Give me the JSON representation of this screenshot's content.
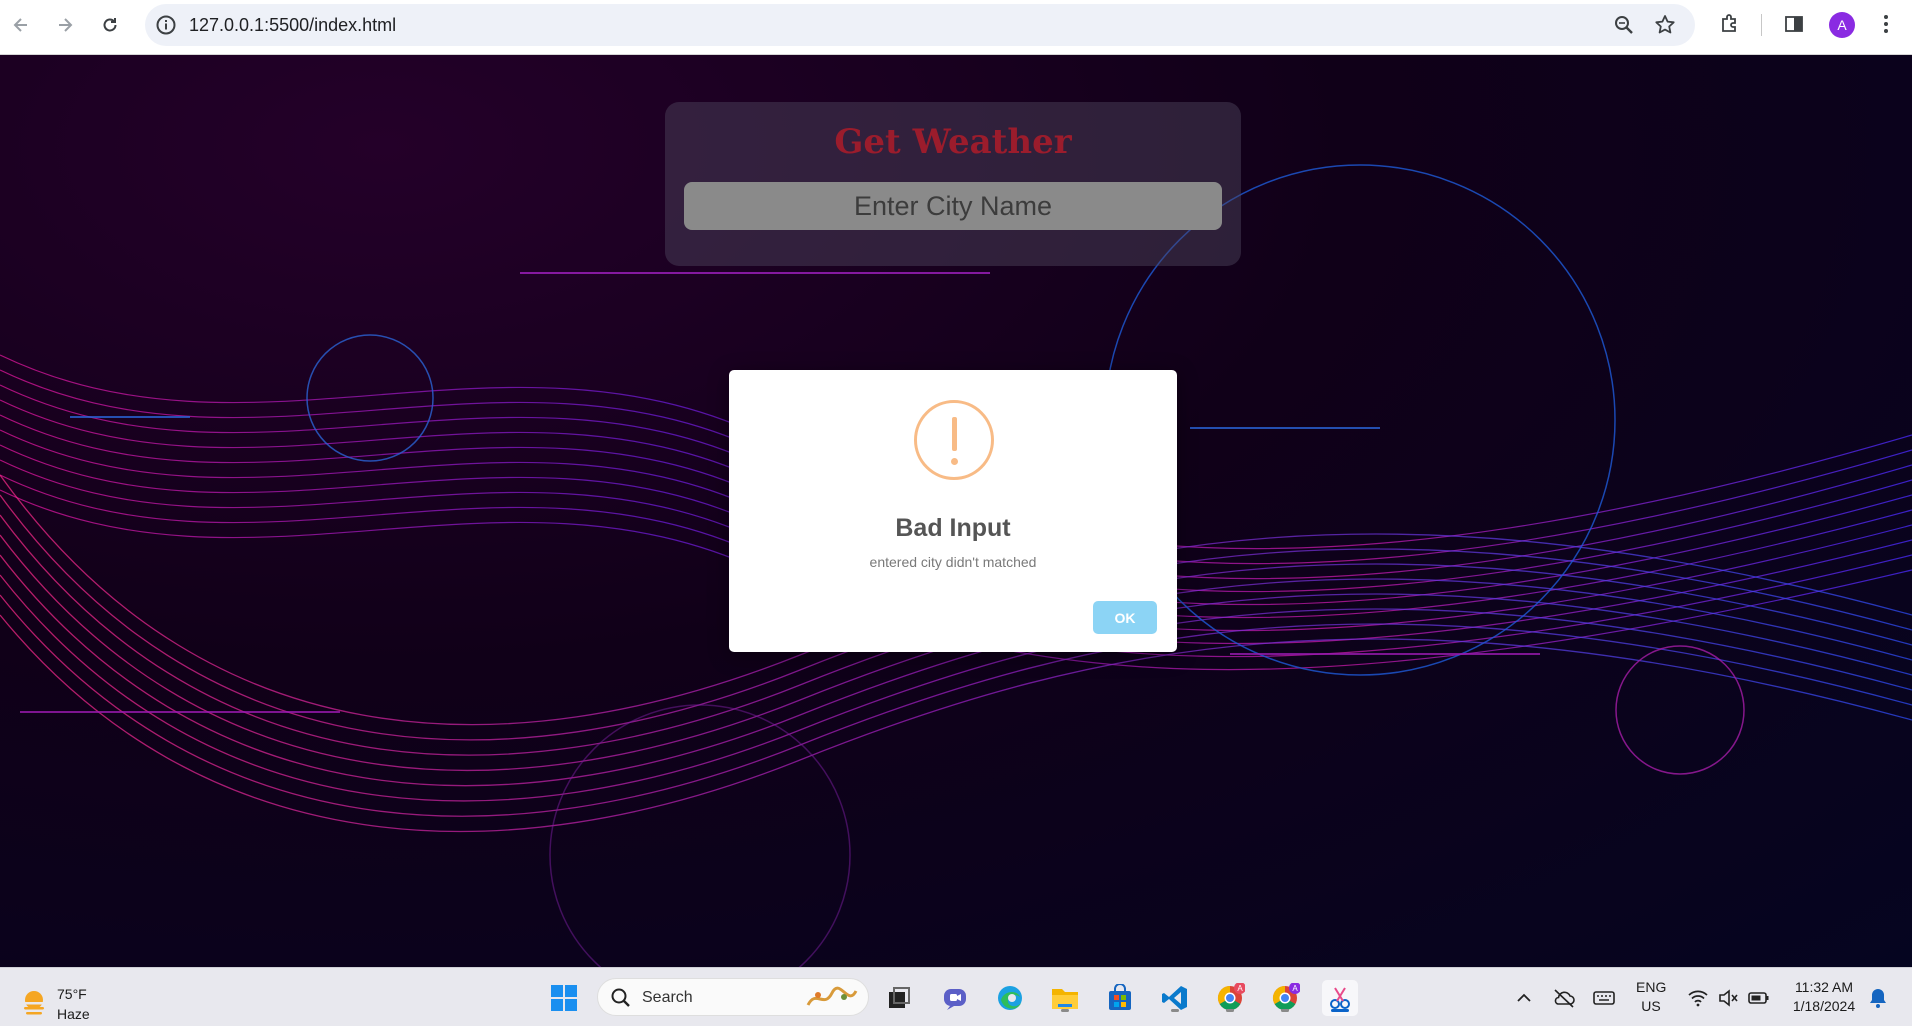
{
  "browser": {
    "url": "127.0.0.1:5500/index.html",
    "profile_initial": "A",
    "icons": [
      "back-icon",
      "forward-icon",
      "reload-icon",
      "site-info-icon",
      "zoom-icon",
      "bookmark-star-icon",
      "extensions-icon",
      "side-panel-icon",
      "menu-icon"
    ]
  },
  "page": {
    "title": "Get Weather",
    "input_placeholder": "Enter City Name",
    "title_color": "#9b1c2c"
  },
  "modal": {
    "icon": "warning-icon",
    "title": "Bad Input",
    "text": "entered city didn't matched",
    "ok_label": "OK",
    "accent": "#f8bb86",
    "button_color": "#8cd4f5"
  },
  "taskbar": {
    "weather_temp": "75°F",
    "weather_condition": "Haze",
    "search_label": "Search",
    "lang_line1": "ENG",
    "lang_line2": "US",
    "time": "11:32 AM",
    "date": "1/18/2024",
    "apps": [
      "start-icon",
      "search-icon",
      "task-view-icon",
      "teams-icon",
      "edge-icon",
      "file-explorer-icon",
      "store-icon",
      "vscode-icon",
      "chrome-icon",
      "chrome-profile-icon",
      "snipping-tool-icon"
    ]
  }
}
